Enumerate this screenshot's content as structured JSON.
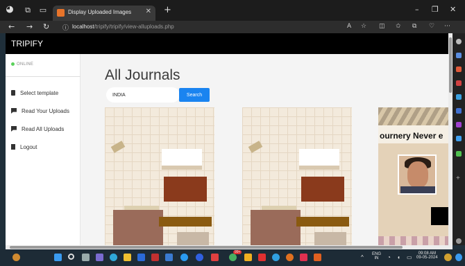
{
  "browser": {
    "tab_title": "Display Uploaded Images",
    "tab_close": "✕",
    "new_tab": "+",
    "url_host": "localhost",
    "url_path": "/tripify/tripify/view-alluploads.php",
    "nav_back": "←",
    "nav_forward": "→",
    "nav_reload": "↻",
    "win_min": "–",
    "win_max": "❐",
    "win_close": "✕"
  },
  "app": {
    "brand": "TRIPIFY",
    "status": "ONLINE",
    "menu": [
      {
        "label": "Select template",
        "icon": "document-icon"
      },
      {
        "label": "Read Your Uploads",
        "icon": "flag-icon"
      },
      {
        "label": "Read All Uploads",
        "icon": "flag-icon"
      },
      {
        "label": "Logout",
        "icon": "exit-icon"
      }
    ]
  },
  "main": {
    "heading": "All Journals",
    "search_value": "INDIA",
    "search_button": "Search"
  },
  "cards": [
    {
      "name": "journal-card-1"
    },
    {
      "name": "journal-card-2"
    },
    {
      "name": "journal-card-3",
      "title": "ournery Never e"
    }
  ],
  "taskbar": {
    "lang_top": "ENG",
    "lang_bottom": "IN",
    "time": "09:08 AM",
    "date": "09-05-2024",
    "badge": "99+"
  },
  "colors": {
    "accent": "#1a84f0",
    "header": "#000000",
    "online": "#5bd15b"
  }
}
